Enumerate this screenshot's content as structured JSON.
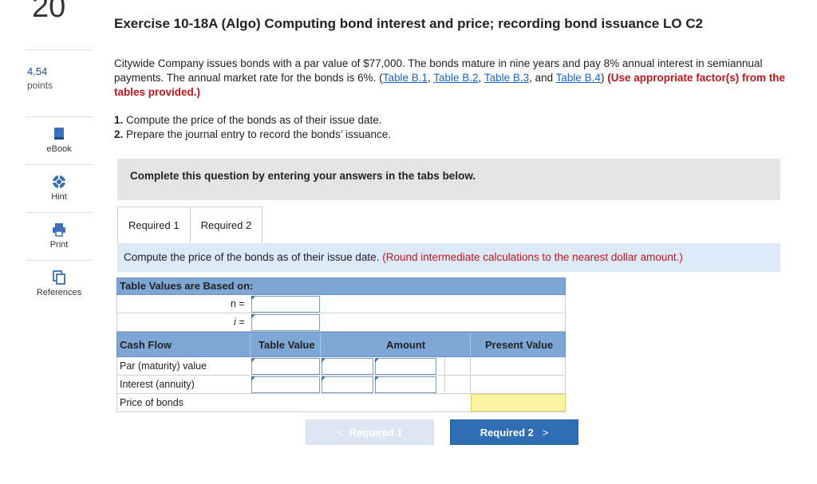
{
  "question": {
    "number": "20",
    "points_value": "4.54",
    "points_label": "points"
  },
  "tools": [
    {
      "label": "eBook",
      "icon": "book-icon"
    },
    {
      "label": "Hint",
      "icon": "lifebuoy-icon"
    },
    {
      "label": "Print",
      "icon": "printer-icon"
    },
    {
      "label": "References",
      "icon": "copy-icon"
    }
  ],
  "title": "Exercise 10-18A (Algo) Computing bond interest and price; recording bond issuance LO C2",
  "intro": {
    "text1": "Citywide Company issues bonds with a par value of $77,000. The bonds mature in nine years and pay 8% annual interest in semiannual payments. The annual market rate for the bonds is 6%. (",
    "link1": "Table B.1",
    "sep1": ", ",
    "link2": "Table B.2",
    "sep2": ", ",
    "link3": "Table B.3",
    "sep3": ", and ",
    "link4": "Table B.4",
    "text2": ") ",
    "red": "(Use appropriate factor(s) from the tables provided.)"
  },
  "tasks": [
    {
      "num": "1.",
      "text": "Compute the price of the bonds as of their issue date."
    },
    {
      "num": "2.",
      "text": "Prepare the journal entry to record the bonds’ issuance."
    }
  ],
  "banner": "Complete this question by entering your answers in the tabs below.",
  "tabs": [
    "Required 1",
    "Required 2"
  ],
  "instruction": {
    "text": "Compute the price of the bonds as of their issue date. ",
    "red": "(Round intermediate calculations to the nearest dollar amount.)"
  },
  "table": {
    "header": "Table Values are Based on:",
    "n_label": "n =",
    "i_label": "i =",
    "columns": [
      "Cash Flow",
      "Table Value",
      "Amount",
      "Present Value"
    ],
    "rows": [
      "Par (maturity) value",
      "Interest (annuity)",
      "Price of bonds"
    ]
  },
  "nav": {
    "prev": "Required 1",
    "next": "Required 2"
  },
  "colors": {
    "header_blue": "#7fa7d6",
    "link_blue": "#1a66c8",
    "red": "#c0161b",
    "next_button": "#2f6db5",
    "highlight_yellow": "#fdf3a0"
  }
}
